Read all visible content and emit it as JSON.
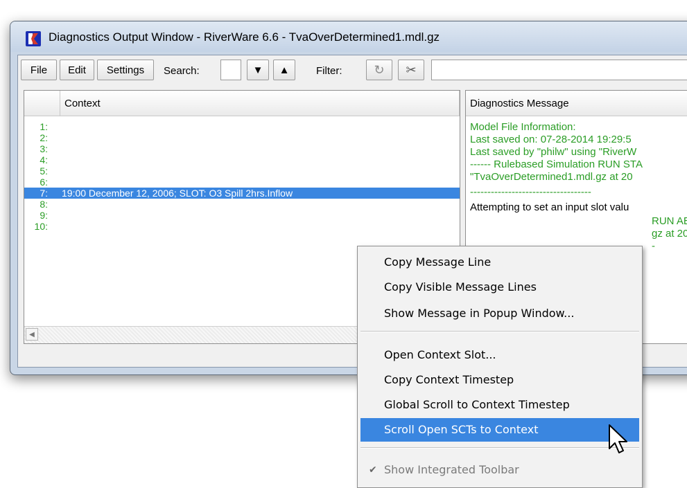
{
  "window": {
    "title": "Diagnostics Output Window - RiverWare 6.6 - TvaOverDetermined1.mdl.gz",
    "icon": "riverware-logo-icon"
  },
  "toolbar": {
    "file": "File",
    "edit": "Edit",
    "settings": "Settings",
    "search_label": "Search:",
    "filter_label": "Filter:",
    "search_down_icon": "triangle-down-icon",
    "search_up_icon": "triangle-up-icon",
    "filter_refresh_icon": "refresh-icon",
    "filter_clear_icon": "scissors-clear-icon"
  },
  "context_pane": {
    "header": "Context",
    "rows": [
      {
        "num": "1:",
        "text": ""
      },
      {
        "num": "2:",
        "text": ""
      },
      {
        "num": "3:",
        "text": ""
      },
      {
        "num": "4:",
        "text": ""
      },
      {
        "num": "5:",
        "text": ""
      },
      {
        "num": "6:",
        "text": ""
      },
      {
        "num": "7:",
        "text": "19:00 December 12, 2006; SLOT: O3 Spill 2hrs.Inflow"
      },
      {
        "num": "8:",
        "text": ""
      },
      {
        "num": "9:",
        "text": ""
      },
      {
        "num": "10:",
        "text": ""
      }
    ]
  },
  "message_pane": {
    "header": "Diagnostics Message",
    "lines": [
      "Model File Information:",
      "Last saved on: 07-28-2014 19:29:5",
      "Last saved by \"philw\" using \"RiverW",
      "------ Rulebased Simulation RUN STA",
      "\"TvaOverDetermined1.mdl.gz at 20",
      "-----------------------------------",
      "Attempting to set an input slot valu",
      "RUN AB",
      "gz at 20",
      "-"
    ]
  },
  "context_menu": {
    "items": [
      "Copy Message Line",
      "Copy Visible Message Lines",
      "Show Message in Popup Window...",
      "Open Context Slot...",
      "Copy Context Timestep",
      "Global Scroll to Context Timestep",
      "Scroll Open SCTs to Context",
      "Show Integrated Toolbar"
    ],
    "highlighted_index": 6,
    "checked_item": "Show Integrated Toolbar"
  },
  "colors": {
    "selection": "#3a86e0",
    "message_text": "#2a9d25"
  }
}
